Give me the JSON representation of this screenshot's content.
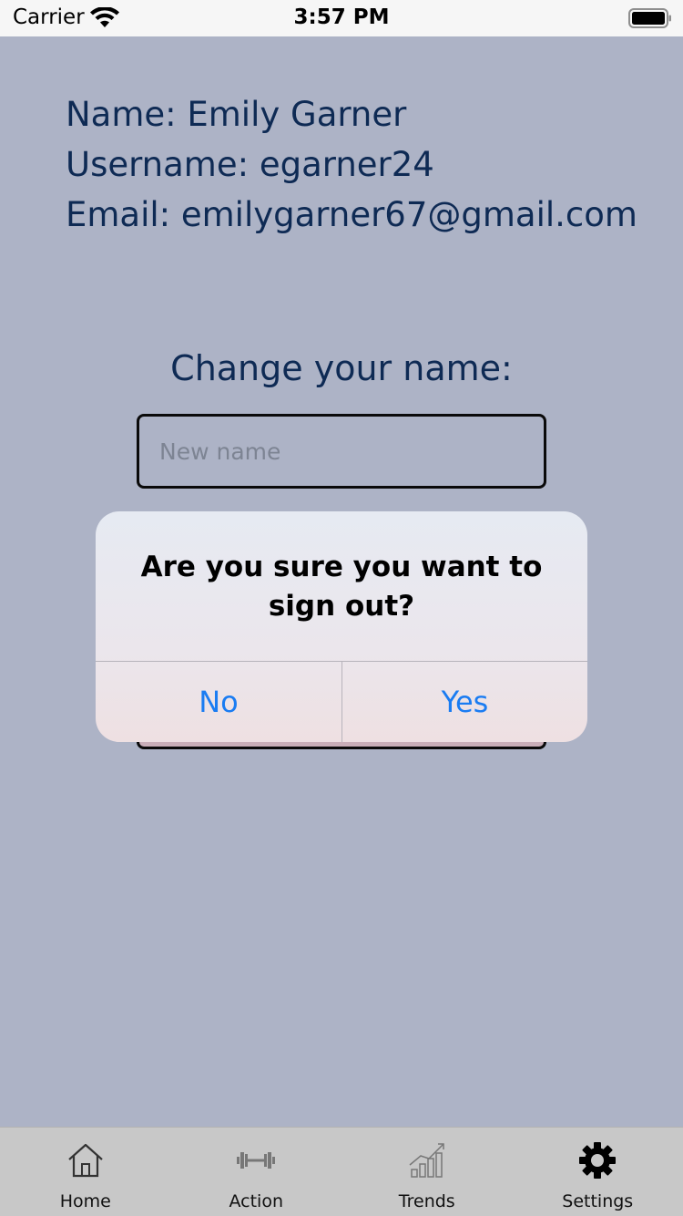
{
  "status_bar": {
    "carrier": "Carrier",
    "time": "3:57 PM"
  },
  "profile": {
    "name_line": "Name: Emily Garner",
    "username_line": "Username: egarner24",
    "email_line": "Email: emilygarner67@gmail.com"
  },
  "change_name": {
    "label": "Change your name:",
    "placeholder": "New name",
    "value": ""
  },
  "alert": {
    "title": "Are you sure you want to sign out?",
    "no_label": "No",
    "yes_label": "Yes"
  },
  "tabs": [
    {
      "label": "Home",
      "icon": "house-icon",
      "active": false
    },
    {
      "label": "Action",
      "icon": "dumbbell-icon",
      "active": false
    },
    {
      "label": "Trends",
      "icon": "trend-chart-icon",
      "active": false
    },
    {
      "label": "Settings",
      "icon": "gear-icon",
      "active": true
    }
  ],
  "colors": {
    "text_navy": "#0e2a54",
    "alert_button_blue": "#1a7cf2",
    "background": "#adb3c6"
  }
}
